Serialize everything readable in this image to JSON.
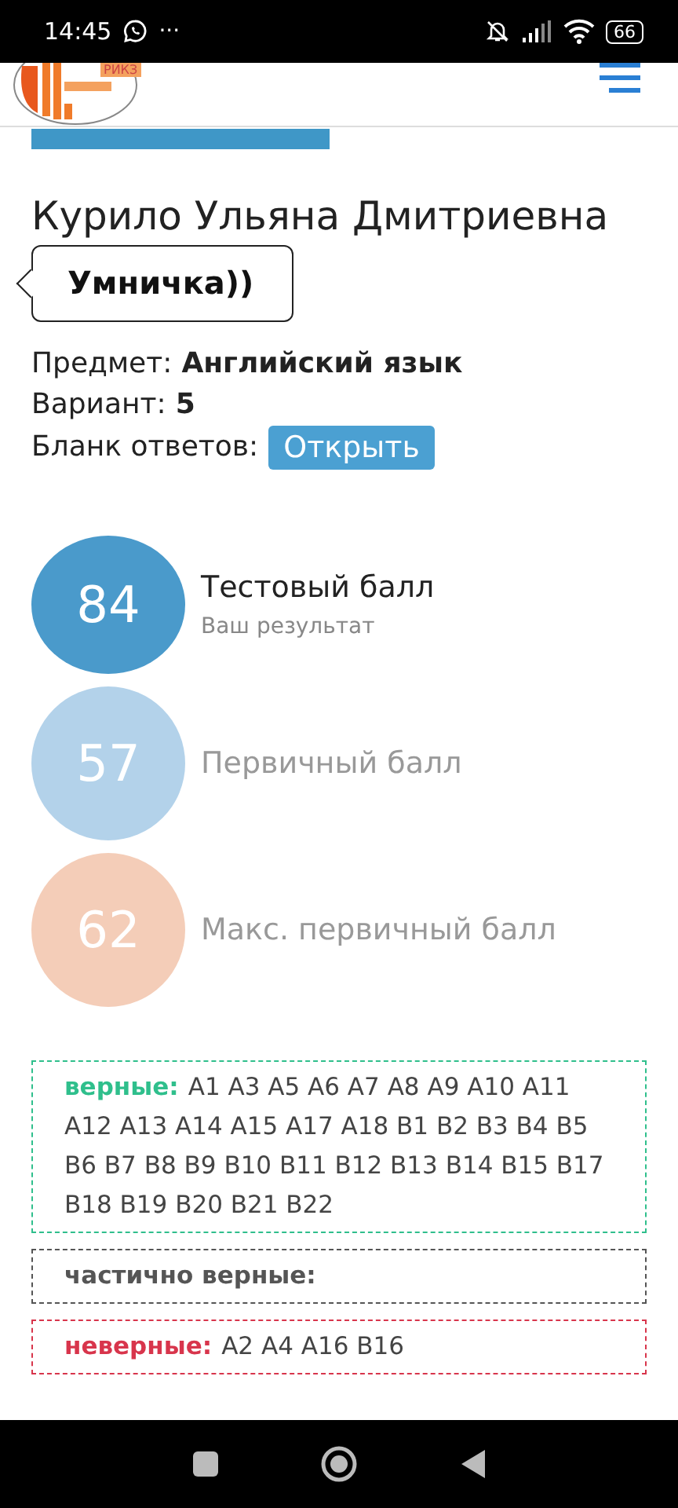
{
  "status_bar": {
    "time": "14:45",
    "more": "···",
    "battery": "66"
  },
  "header": {
    "logo_text": "РИКЗ"
  },
  "student": {
    "name": "Курило Ульяна Дмитриевна",
    "comment": "Умничка))"
  },
  "info": [
    {
      "label": "Предмет:",
      "value": "Английский язык"
    },
    {
      "label": "Вариант:",
      "value": "5"
    }
  ],
  "answer_sheet": {
    "label": "Бланк ответов:",
    "button": "Открыть"
  },
  "scores": [
    {
      "value": "84",
      "title": "Тестовый балл",
      "subtitle": "Ваш результат",
      "color": "#4a9acb",
      "faded": false
    },
    {
      "value": "57",
      "title": "Первичный балл",
      "color": "#b3d2ea",
      "faded": true
    },
    {
      "value": "62",
      "title": "Макс. первичный балл",
      "color": "#f4cdb8",
      "faded": true
    }
  ],
  "answers": [
    {
      "label": "верные:",
      "items": "A1 A3 A5 A6 A7 A8 A9 A10 A11 A12 A13 A14 A15 A17 A18 B1 B2 B3 B4 B5 B6 B7 B8 B9 B10 B11 B12 B13 B14 B15 B17 B18 B19 B20 B21 B22",
      "color": "#2fbf8c"
    },
    {
      "label": "частично верные:",
      "color": "#555555"
    },
    {
      "label": "неверные:",
      "items": "A2 A4 A16 B16",
      "color": "#d8354c"
    }
  ]
}
